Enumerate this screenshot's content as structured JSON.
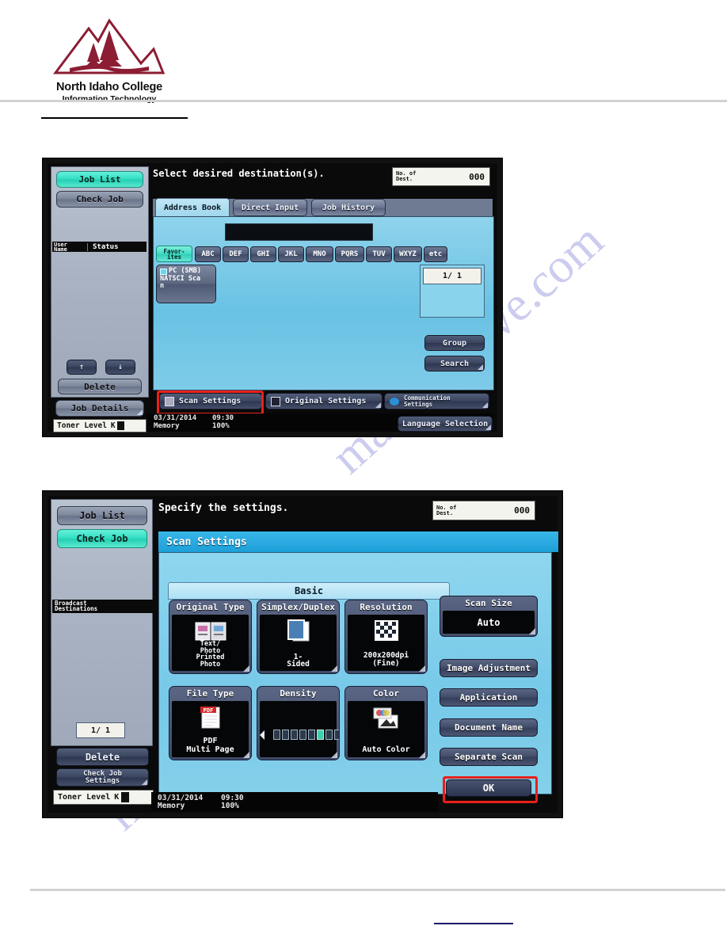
{
  "header": {
    "org_name": "North Idaho College",
    "dept_name": "Information Technology"
  },
  "screen1": {
    "prompt": "Select desired destination(s).",
    "dest_counter": {
      "label_line1": "No. of",
      "label_line2": "Dest.",
      "value": "000"
    },
    "left_panel": {
      "job_list": "Job List",
      "check_job": "Check Job",
      "col_user_line1": "User",
      "col_user_line2": "Name",
      "col_status": "Status",
      "arrow_up": "↑",
      "arrow_down": "↓",
      "delete": "Delete",
      "job_details": "Job Details",
      "toner_label": "Toner Level",
      "toner_color": "K"
    },
    "tabs": [
      {
        "label": "Address Book",
        "active": true
      },
      {
        "label": "Direct Input",
        "active": false
      },
      {
        "label": "Job History",
        "active": false
      }
    ],
    "index_buttons": [
      "Favor-\nites",
      "ABC",
      "DEF",
      "GHI",
      "JKL",
      "MNO",
      "PQRS",
      "TUV",
      "WXYZ",
      "etc"
    ],
    "address_entry": {
      "type": "PC (SMB)",
      "name_line1": "NATSCI Sca",
      "name_line2": "n"
    },
    "page_indicator": "1/  1",
    "right_buttons": [
      "Group",
      "Search"
    ],
    "bottom_buttons": [
      {
        "label": "Scan Settings",
        "icon": "scan-icon",
        "highlighted": true
      },
      {
        "label": "Original Settings",
        "icon": "original-icon",
        "highlighted": false
      },
      {
        "label": "Communication\nSettings",
        "icon": "communication-icon",
        "highlighted": false
      }
    ],
    "language_selection": "Language Selection",
    "status": {
      "date": "03/31/2014",
      "time": "09:30",
      "memory_label": "Memory",
      "memory_value": "100%"
    }
  },
  "screen2": {
    "prompt": "Specify the settings.",
    "dest_counter": {
      "label_line1": "No. of",
      "label_line2": "Dest.",
      "value": "000"
    },
    "left_panel": {
      "job_list": "Job List",
      "check_job": "Check Job",
      "broadcast_line1": "Broadcast",
      "broadcast_line2": "Destinations",
      "page_indicator": "1/  1",
      "delete": "Delete",
      "check_job_settings_line1": "Check Job",
      "check_job_settings_line2": "Settings",
      "toner_label": "Toner Level",
      "toner_color": "K"
    },
    "section_title": "Scan Settings",
    "tab_basic": "Basic",
    "tiles": [
      {
        "name": "original-type",
        "title": "Original Type",
        "icon": "document-photo-icon",
        "value_lines": [
          "Text/",
          "Photo",
          "Printed",
          "Photo"
        ]
      },
      {
        "name": "simplex-duplex",
        "title": "Simplex/Duplex",
        "icon": "pages-icon",
        "value_lines": [
          "1-",
          "Sided"
        ]
      },
      {
        "name": "resolution",
        "title": "Resolution",
        "icon": "halftone-icon",
        "value_lines": [
          "200x200dpi",
          "(Fine)"
        ]
      },
      {
        "name": "file-type",
        "title": "File Type",
        "icon": "pdf-icon",
        "value_lines": [
          "PDF",
          "Multi Page"
        ]
      },
      {
        "name": "density",
        "title": "Density",
        "icon": "density-slider-icon",
        "value_lines": []
      },
      {
        "name": "color",
        "title": "Color",
        "icon": "color-scan-icon",
        "value_lines": [
          "Auto Color"
        ]
      }
    ],
    "density_segments": 10,
    "density_active_index": 5,
    "scan_size": {
      "title": "Scan Size",
      "value": "Auto"
    },
    "side_buttons": [
      "Image Adjustment",
      "Application",
      "Document Name",
      "Separate Scan"
    ],
    "ok_button": "OK",
    "status": {
      "date": "03/31/2014",
      "time": "09:30",
      "memory_label": "Memory",
      "memory_value": "100%"
    }
  },
  "watermark": {
    "text": "manualshive.com"
  },
  "colors": {
    "accent_teal": "#35e0c4",
    "highlight_red": "#e8201a",
    "panel_blue": "#76c9e8",
    "logo_maroon": "#8c1d33"
  }
}
